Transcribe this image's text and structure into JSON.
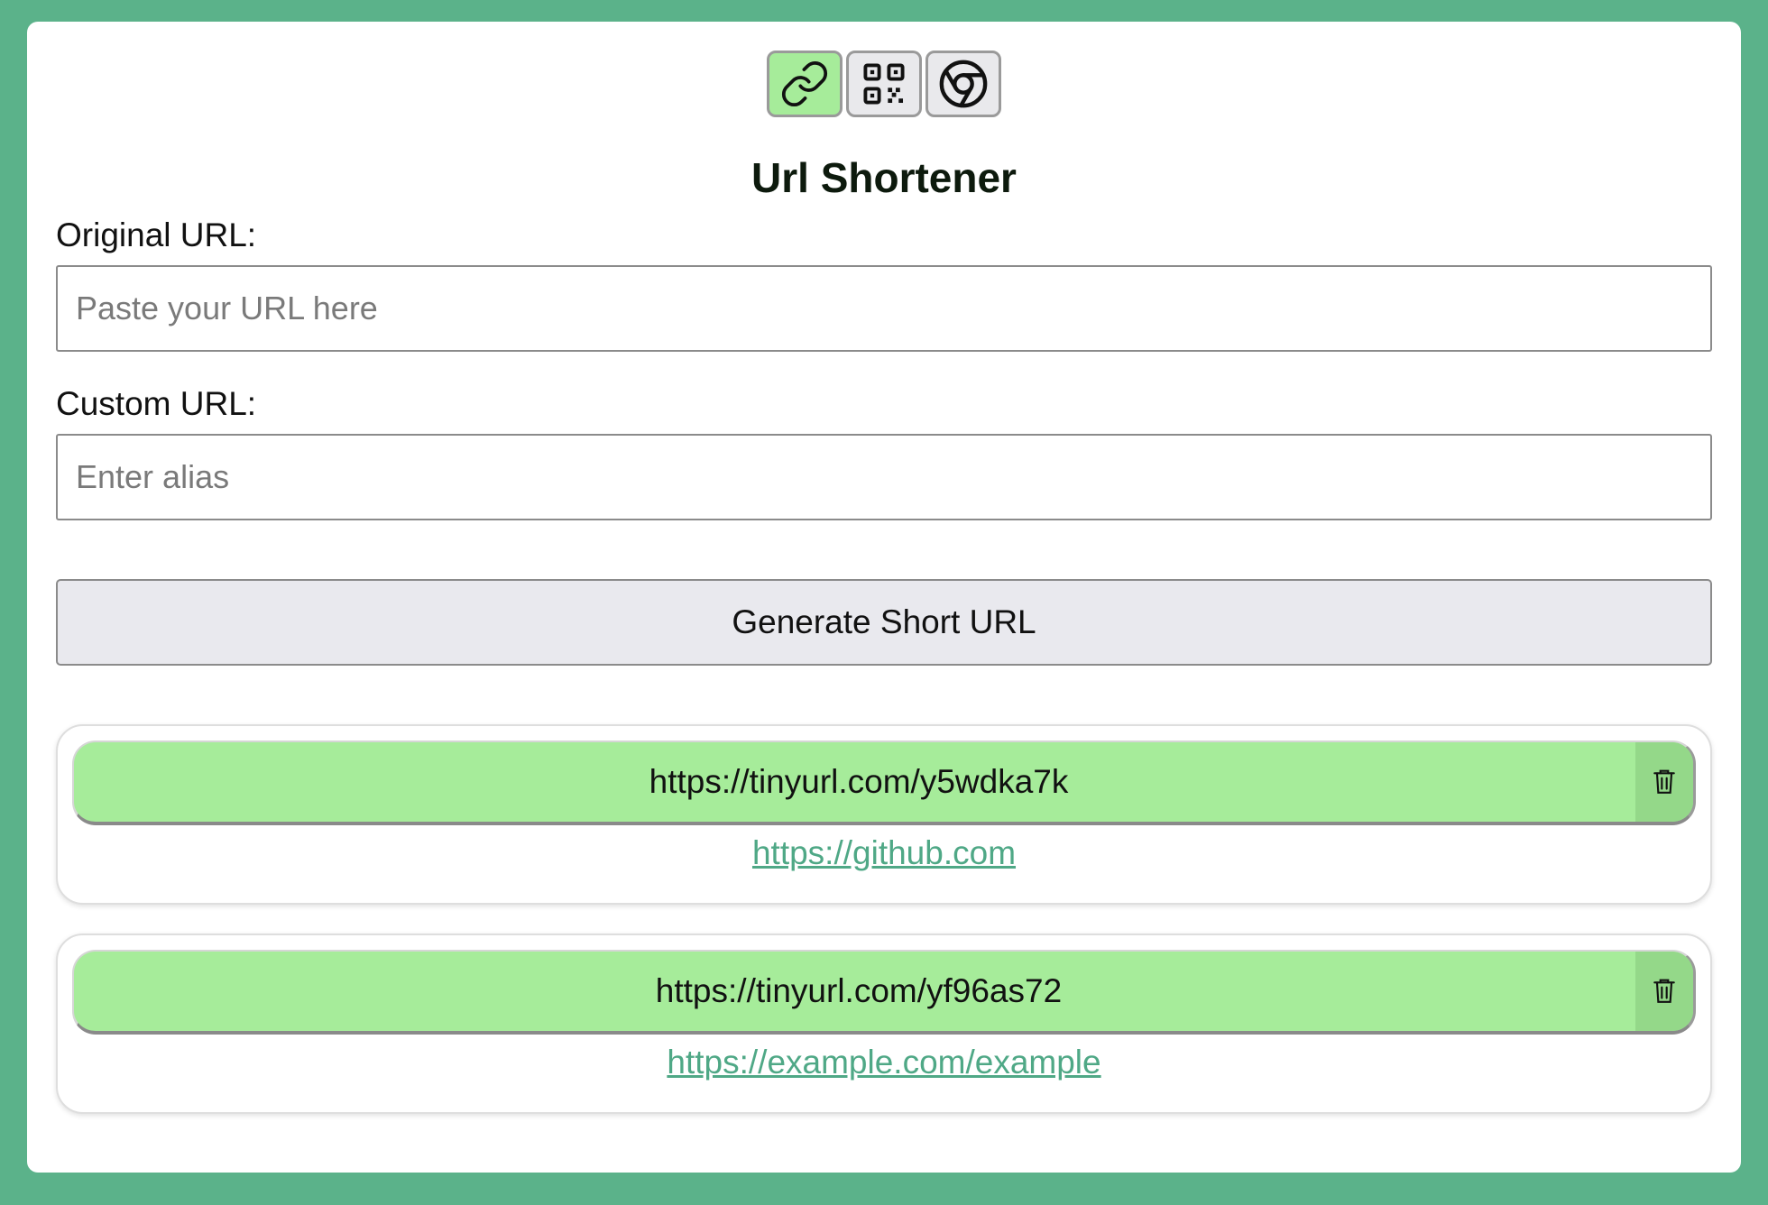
{
  "tabs": [
    {
      "name": "link-icon",
      "active": true
    },
    {
      "name": "qr-code-icon",
      "active": false
    },
    {
      "name": "chrome-icon",
      "active": false
    }
  ],
  "title": "Url Shortener",
  "form": {
    "original_label": "Original URL:",
    "original_placeholder": "Paste your URL here",
    "original_value": "",
    "custom_label": "Custom URL:",
    "custom_placeholder": "Enter alias",
    "custom_value": "",
    "generate_label": "Generate Short URL"
  },
  "results": [
    {
      "short_url": "https://tinyurl.com/y5wdka7k",
      "original_url": "https://github.com",
      "delete_icon": "trash-icon"
    },
    {
      "short_url": "https://tinyurl.com/yf96as72",
      "original_url": "https://example.com/example",
      "delete_icon": "trash-icon"
    }
  ],
  "colors": {
    "background": "#5bb28a",
    "accent": "#a6ec9a",
    "accent_dark": "#94d889",
    "link": "#4fa886"
  }
}
